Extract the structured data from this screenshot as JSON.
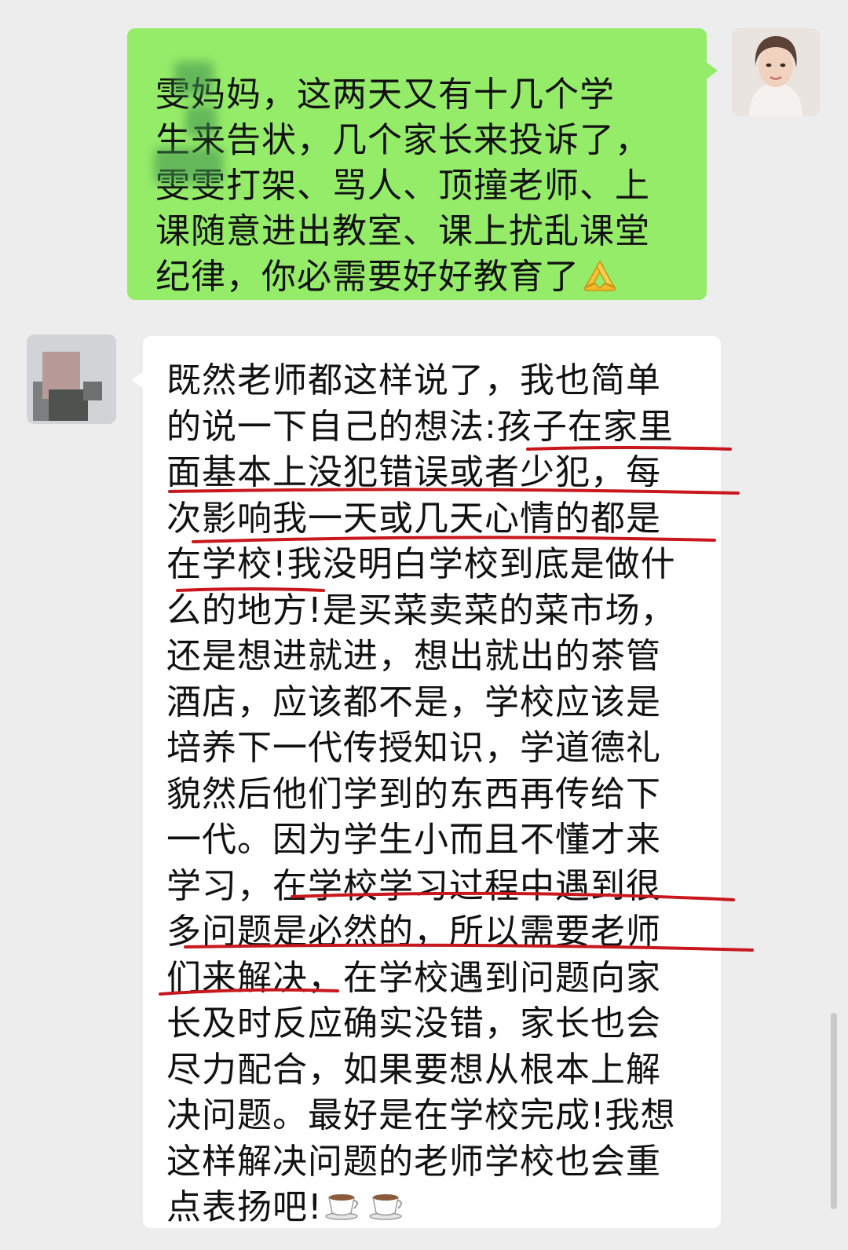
{
  "messages": {
    "sent": {
      "lines": [
        "雯妈妈，这两天又有十几个学",
        "生来告状，几个家长来投诉了，",
        "雯雯打架、骂人、顶撞老师、上",
        "课随意进出教室、课上扰乱课堂",
        "纪律，你必需要好好教育了"
      ],
      "emoji": "folded-hands-icon",
      "bubble_color": "#95ec69"
    },
    "received": {
      "lines": [
        "既然老师都这样说了，我也简单",
        "的说一下自己的想法:孩子在家里",
        "面基本上没犯错误或者少犯，每",
        "次影响我一天或几天心情的都是",
        "在学校!我没明白学校到底是做什",
        "么的地方!是买菜卖菜的菜市场，",
        "还是想进就进，想出就出的茶管",
        "酒店，应该都不是，学校应该是",
        "培养下一代传授知识，学道德礼",
        "貌然后他们学到的东西再传给下",
        "一代。因为学生小而且不懂才来",
        "学习，在学校学习过程中遇到很",
        "多问题是必然的，所以需要老师",
        "们来解决，在学校遇到问题向家",
        "长及时反应确实没错，家长也会",
        "尽力配合，如果要想从根本上解",
        "决问题。最好是在学校完成!我想",
        "这样解决问题的老师学校也会重",
        "点表扬吧!"
      ],
      "emoji": [
        "coffee-icon",
        "coffee-icon"
      ],
      "bubble_color": "#ffffff"
    }
  },
  "colors": {
    "background": "#ededed",
    "underline": "#c8181e"
  }
}
